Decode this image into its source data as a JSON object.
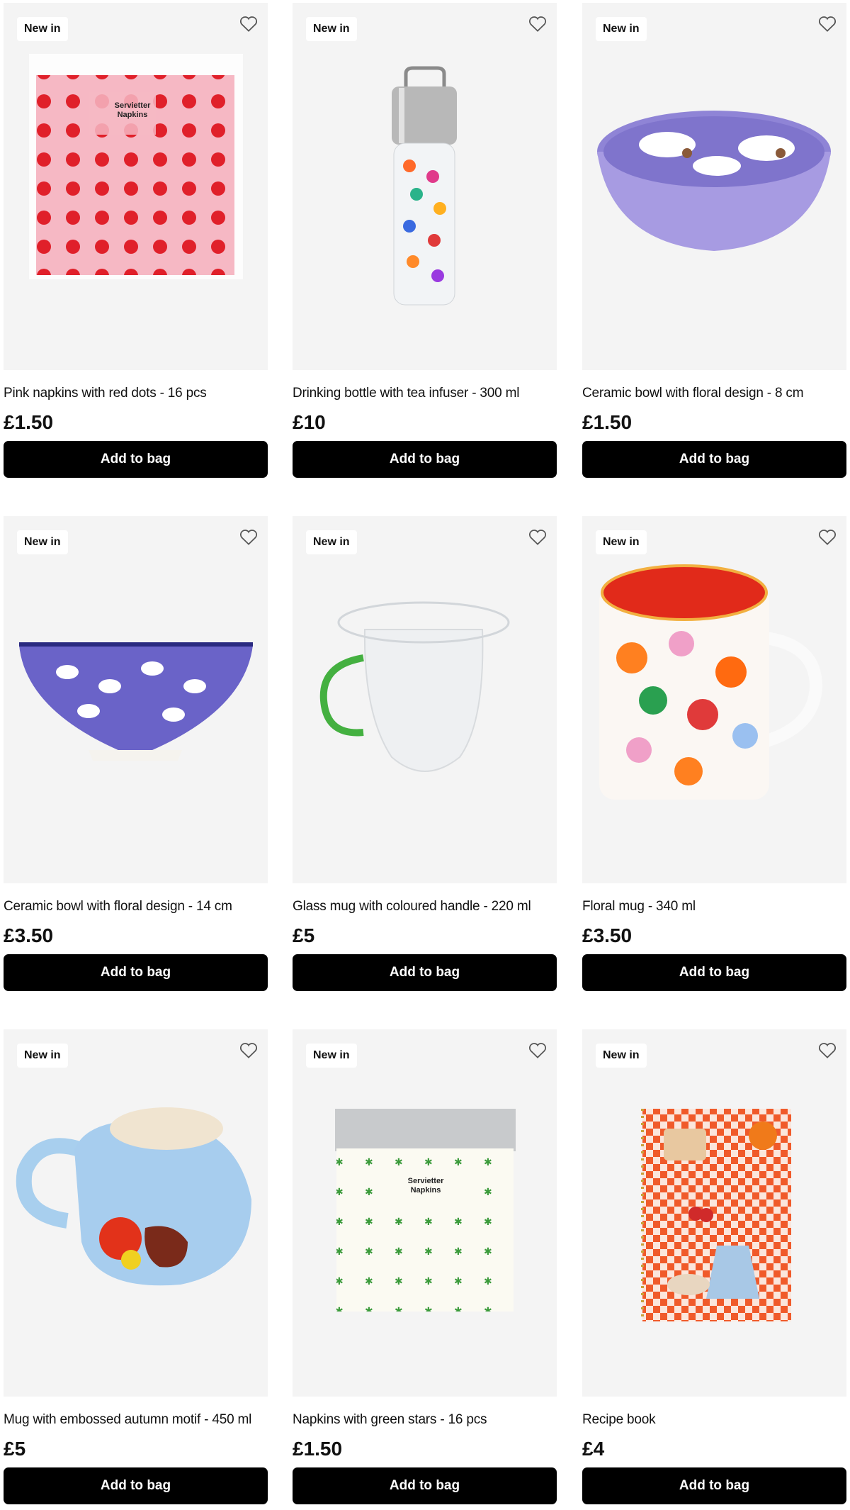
{
  "products": [
    {
      "badge": "New in",
      "title": "Pink napkins with red dots - 16 pcs",
      "price": "£1.50",
      "button": "Add to bag",
      "packaging_text": [
        "Servietter",
        "Napkins"
      ]
    },
    {
      "badge": "New in",
      "title": "Drinking bottle with tea infuser - 300 ml",
      "price": "£10",
      "button": "Add to bag"
    },
    {
      "badge": "New in",
      "title": "Ceramic bowl with floral design - 8 cm",
      "price": "£1.50",
      "button": "Add to bag"
    },
    {
      "badge": "New in",
      "title": "Ceramic bowl with floral design - 14 cm",
      "price": "£3.50",
      "button": "Add to bag"
    },
    {
      "badge": "New in",
      "title": "Glass mug with coloured handle - 220 ml",
      "price": "£5",
      "button": "Add to bag"
    },
    {
      "badge": "New in",
      "title": "Floral mug - 340 ml",
      "price": "£3.50",
      "button": "Add to bag"
    },
    {
      "badge": "New in",
      "title": "Mug with embossed autumn motif - 450 ml",
      "price": "£5",
      "button": "Add to bag"
    },
    {
      "badge": "New in",
      "title": "Napkins with green stars - 16 pcs",
      "price": "£1.50",
      "button": "Add to bag",
      "packaging_text": [
        "Servietter",
        "Napkins"
      ]
    },
    {
      "badge": "New in",
      "title": "Recipe book",
      "price": "£4",
      "button": "Add to bag"
    }
  ],
  "icons": {
    "wishlist": "heart-outline-icon"
  },
  "colors": {
    "button_bg": "#000000",
    "image_bg": "#f4f4f4",
    "text": "#111111"
  }
}
